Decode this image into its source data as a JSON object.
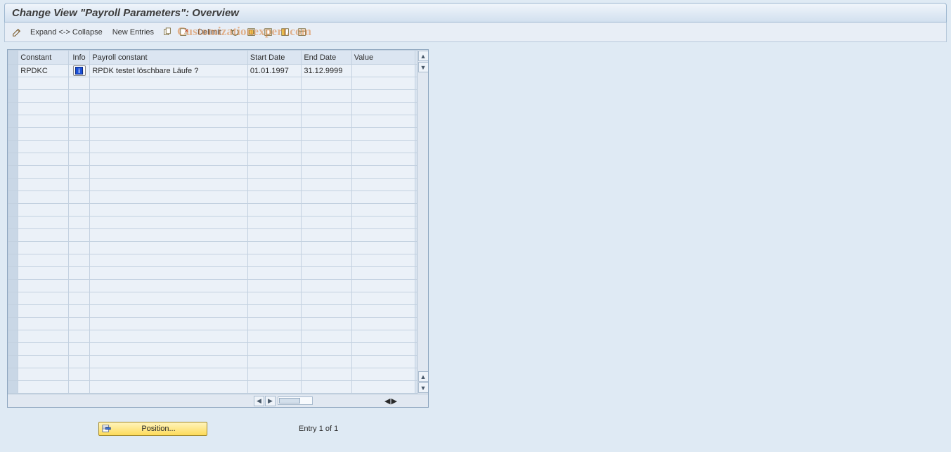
{
  "title": "Change View \"Payroll Parameters\": Overview",
  "toolbar": {
    "expand_collapse": "Expand <-> Collapse",
    "new_entries": "New Entries",
    "delimit": "Delimit"
  },
  "watermark": "Customizationexpert.com",
  "columns": {
    "constant": "Constant",
    "info": "Info",
    "payroll_constant": "Payroll constant",
    "start_date": "Start Date",
    "end_date": "End Date",
    "value": "Value"
  },
  "rows": [
    {
      "constant": "RPDKC",
      "info_icon": "i",
      "payroll_constant": "RPDK testet löschbare Läufe ?",
      "start_date": "01.01.1997",
      "end_date": "31.12.9999",
      "value": ""
    }
  ],
  "empty_row_count": 25,
  "footer": {
    "position_label": "Position...",
    "entry_text": "Entry 1 of 1"
  }
}
